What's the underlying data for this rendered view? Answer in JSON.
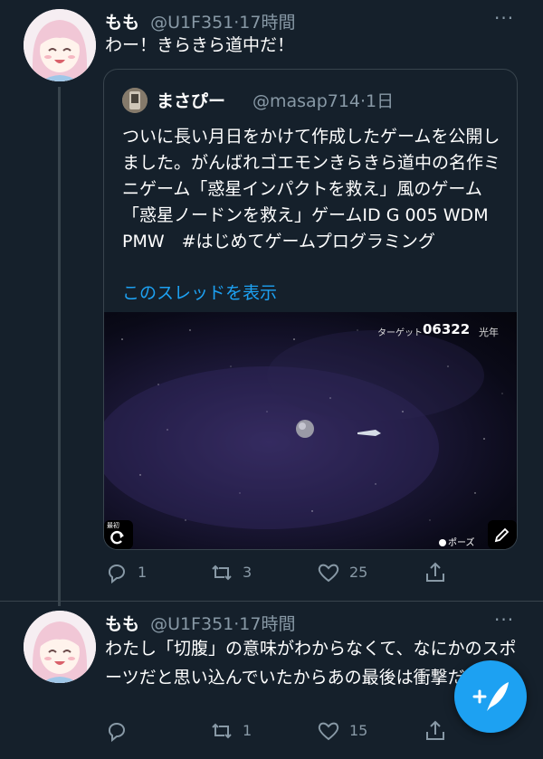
{
  "tweet1": {
    "name": "もも",
    "handle_time": "@U1F351·17時間",
    "more": "···",
    "text": "わー！きらきら道中だ！",
    "quote": {
      "name": "まさぴー",
      "handle_time": "@masap714·1日",
      "text": "ついに長い月日をかけて作成したゲームを公開しました。がんばれゴエモンきらきら道中の名作ミニゲーム「惑星インパクトを救え」風のゲーム「惑星ノードンを救え」ゲームID G 005 WDM PMW　#はじめてゲームプログラミング",
      "thread_link": "このスレッドを表示",
      "game": {
        "hud_label": "ターゲット",
        "hud_value": "06322",
        "hud_unit": "光年",
        "replay_label": "最初",
        "pause_label": "ポーズ"
      }
    },
    "replies": "1",
    "retweets": "3",
    "likes": "25"
  },
  "tweet2": {
    "name": "もも",
    "handle_time": "@U1F351·17時間",
    "more": "···",
    "text": "わたし「切腹」の意味がわからなくて、なにかのスポーツだと思い込んでいたからあの最後は衝撃だった",
    "replies": "",
    "retweets": "1",
    "likes": "15"
  },
  "colors": {
    "background": "#15202b",
    "secondary_text": "#8899a6",
    "accent": "#1da1f2",
    "border": "#38444d"
  }
}
